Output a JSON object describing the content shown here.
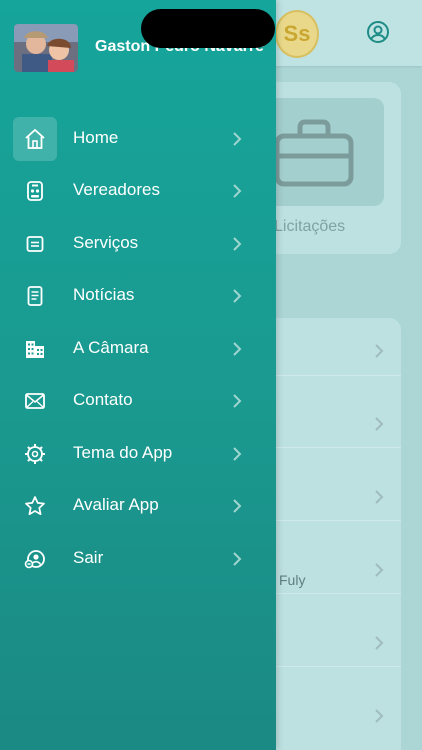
{
  "background": {
    "logo_text": "Ss",
    "card_label": "Licitações",
    "list_snippet": "Fuly"
  },
  "drawer": {
    "user_name": "Gaston Pedro Navarre",
    "items": [
      {
        "label": "Home",
        "icon": "home-icon",
        "active": true
      },
      {
        "label": "Vereadores",
        "icon": "councilor-icon"
      },
      {
        "label": "Serviços",
        "icon": "services-icon"
      },
      {
        "label": "Notícias",
        "icon": "news-icon"
      },
      {
        "label": "A Câmara",
        "icon": "building-icon"
      },
      {
        "label": "Contato",
        "icon": "mail-icon"
      },
      {
        "label": "Tema do App",
        "icon": "theme-icon"
      },
      {
        "label": "Avaliar App",
        "icon": "star-icon"
      },
      {
        "label": "Sair",
        "icon": "logout-icon"
      }
    ]
  },
  "colors": {
    "drawer_top": "#16a59b",
    "drawer_bottom": "#1b8984",
    "background": "#acd6d6"
  }
}
